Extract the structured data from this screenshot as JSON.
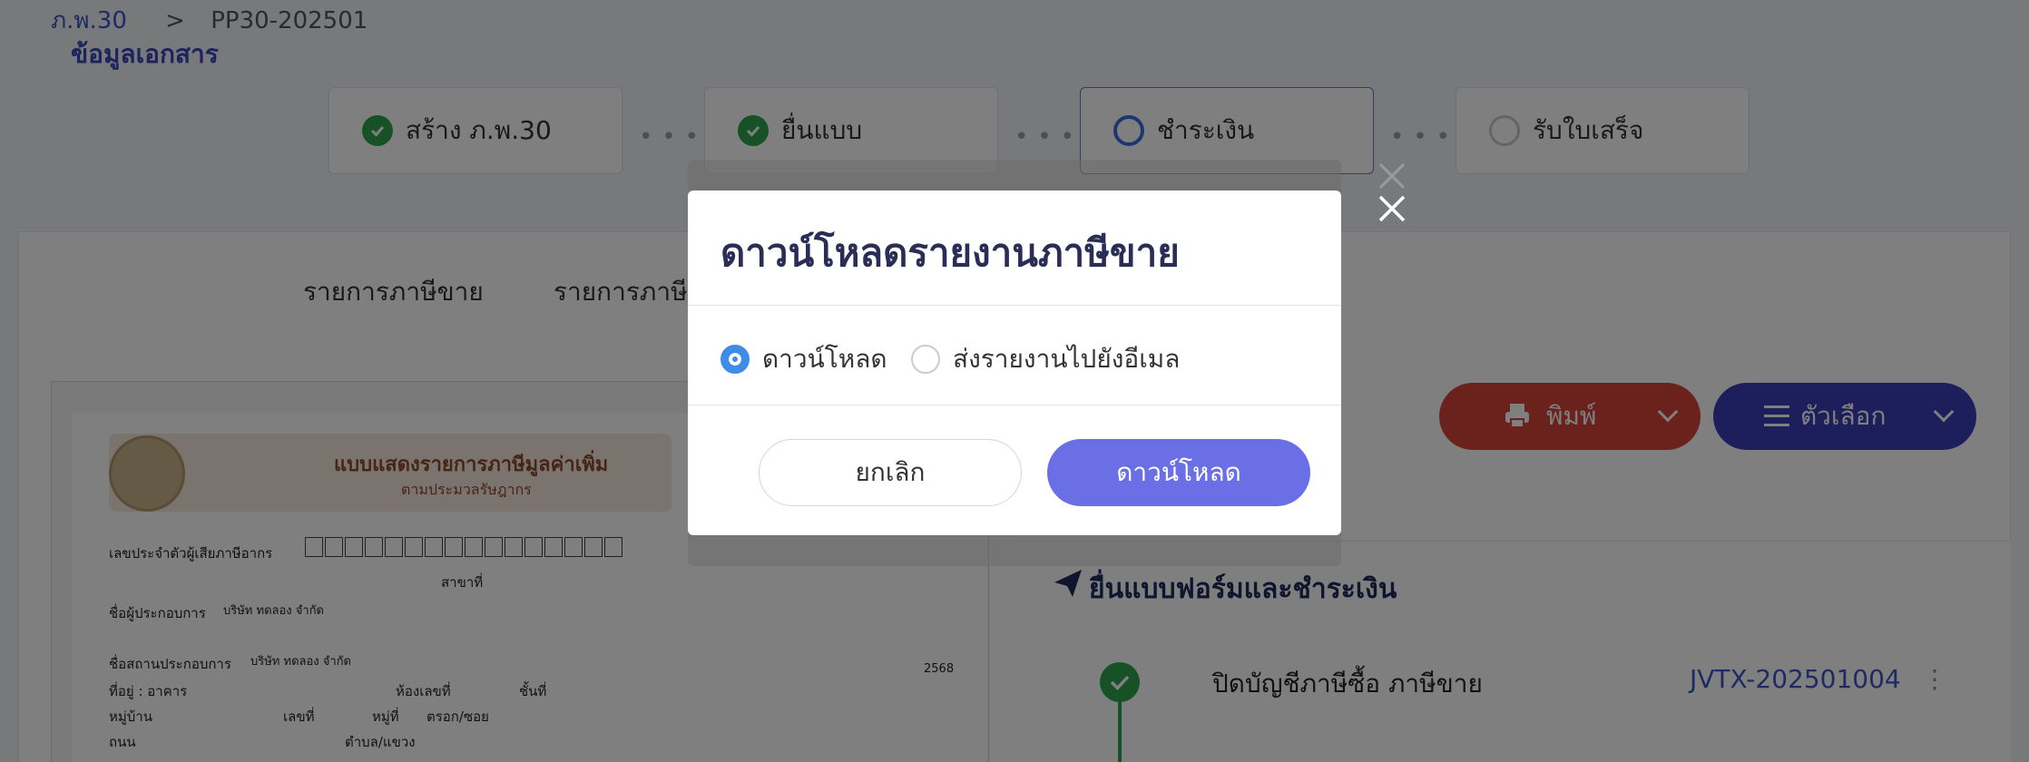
{
  "breadcrumb": {
    "root": "ภ.พ.30",
    "separator": ">",
    "current": "PP30-202501"
  },
  "steps": [
    {
      "label": "สร้าง ภ.พ.30",
      "state": "done"
    },
    {
      "label": "ยื่นแบบ",
      "state": "done"
    },
    {
      "label": "ชำระเงิน",
      "state": "in-progress"
    },
    {
      "label": "รับใบเสร็จ",
      "state": "todo"
    }
  ],
  "tabs": [
    {
      "label": "ข้อมูลเอกสาร",
      "active": true
    },
    {
      "label": "รายการภาษีขาย",
      "active": false
    },
    {
      "label": "รายการภาษีซื้อ",
      "active": false
    }
  ],
  "document": {
    "title": "แบบแสดงรายการภาษีมูลค่าเพิ่ม",
    "subtitle": "ตามประมวลรัษฎากร",
    "tax_id_label": "เลขประจำตัวผู้เสียภาษีอากร",
    "branch_label": "สาขาที่",
    "operator_label": "ชื่อผู้ประกอบการ",
    "operator_value": "บริษัท ทดลอง จำกัด",
    "place_label": "ชื่อสถานประกอบการ",
    "place_value": "บริษัท ทดลอง จำกัด",
    "address_label": "ที่อยู่ : อาคาร",
    "room_label": "ห้องเลขที่",
    "floor_label": "ชั้นที่",
    "village_label": "หมู่บ้าน",
    "number_label": "เลขที่",
    "moo_label": "หมู่ที่",
    "soi_label": "ตรอก/ซอย",
    "road_label": "ถนน",
    "subdistrict_label": "ตำบล/แขวง",
    "year_value": "2568"
  },
  "toolbar": {
    "print_label": "พิมพ์",
    "options_label": "ตัวเลือก"
  },
  "panel": {
    "title": "ยื่นแบบฟอร์มและชำระเงิน",
    "entry_name": "ปิดบัญชีภาษีซื้อ ภาษีขาย",
    "entry_ref": "JVTX-202501004",
    "kebab": "⋮"
  },
  "modal": {
    "title": "ดาวน์โหลดรายงานภาษีขาย",
    "options": [
      {
        "label": "ดาวน์โหลด",
        "selected": true
      },
      {
        "label": "ส่งรายงานไปยังอีเมล",
        "selected": false
      }
    ],
    "cancel_label": "ยกเลิก",
    "confirm_label": "ดาวน์โหลด"
  },
  "colors": {
    "primary": "#6b6fe6",
    "success": "#2ea24c",
    "print": "#d7443a",
    "options": "#3a3fb8",
    "radio": "#3f8ce8"
  }
}
